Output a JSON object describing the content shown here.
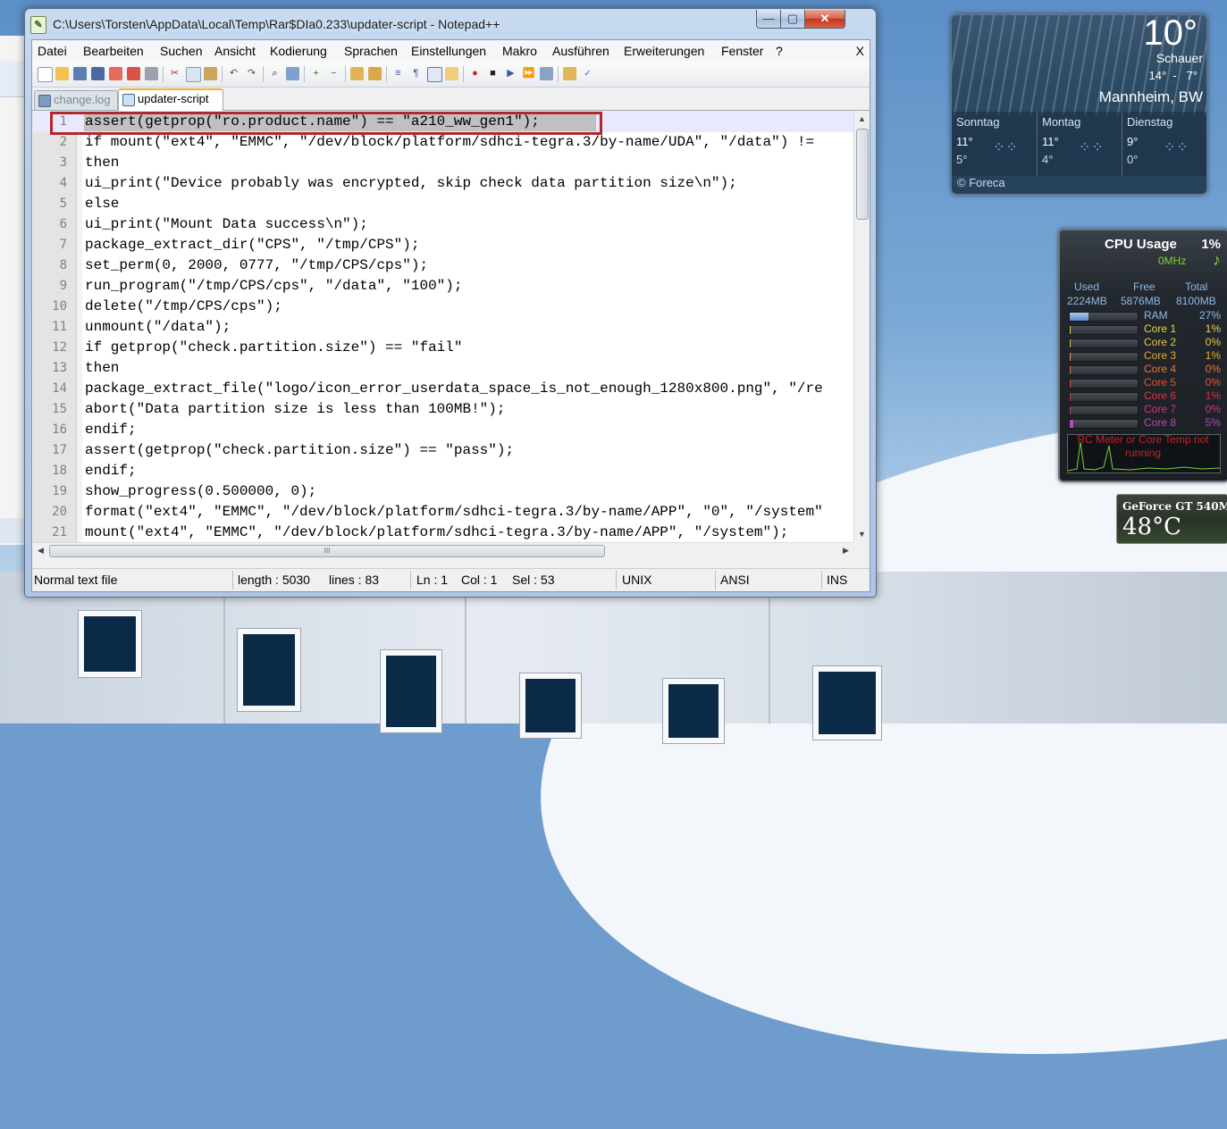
{
  "window": {
    "title": "C:\\Users\\Torsten\\AppData\\Local\\Temp\\Rar$DIa0.233\\updater-script - Notepad++",
    "close_glyph": "✕",
    "max_glyph": "▢",
    "min_glyph": "—"
  },
  "menu": {
    "items": [
      "Datei",
      "Bearbeiten",
      "Suchen",
      "Ansicht",
      "Kodierung",
      "Sprachen",
      "Einstellungen",
      "Makro",
      "Ausführen",
      "Erweiterungen",
      "Fenster",
      "?"
    ],
    "close": "X"
  },
  "toolbar": {
    "icons": [
      "new-file-icon",
      "open-file-icon",
      "save-icon",
      "save-all-icon",
      "close-icon",
      "close-all-icon",
      "print-icon",
      "cut-icon",
      "copy-icon",
      "paste-icon",
      "undo-icon",
      "redo-icon",
      "find-icon",
      "replace-icon",
      "zoom-in-icon",
      "zoom-out-icon",
      "sync-vertical-icon",
      "sync-horizontal-icon",
      "word-wrap-icon",
      "show-all-chars-icon",
      "indent-guide-icon",
      "doc-map-icon",
      "record-macro-icon",
      "stop-macro-icon",
      "play-macro-icon",
      "run-macro-multiple-icon",
      "save-macro-icon",
      "preview-icon",
      "spellcheck-icon"
    ]
  },
  "tabs": [
    {
      "label": "change.log",
      "active": false
    },
    {
      "label": "updater-script",
      "active": true
    }
  ],
  "editor": {
    "lines": [
      {
        "n": "1",
        "text": "assert(getprop(\"ro.product.name\") == \"a210_ww_gen1\");"
      },
      {
        "n": "2",
        "text": "if mount(\"ext4\", \"EMMC\", \"/dev/block/platform/sdhci-tegra.3/by-name/UDA\", \"/data\") !="
      },
      {
        "n": "3",
        "text": "then"
      },
      {
        "n": "4",
        "text": "ui_print(\"Device probably was encrypted, skip check data partition size\\n\");"
      },
      {
        "n": "5",
        "text": "else"
      },
      {
        "n": "6",
        "text": "ui_print(\"Mount Data success\\n\");"
      },
      {
        "n": "7",
        "text": "package_extract_dir(\"CPS\", \"/tmp/CPS\");"
      },
      {
        "n": "8",
        "text": "set_perm(0, 2000, 0777, \"/tmp/CPS/cps\");"
      },
      {
        "n": "9",
        "text": "run_program(\"/tmp/CPS/cps\", \"/data\", \"100\");"
      },
      {
        "n": "10",
        "text": "delete(\"/tmp/CPS/cps\");"
      },
      {
        "n": "11",
        "text": "unmount(\"/data\");"
      },
      {
        "n": "12",
        "text": "if getprop(\"check.partition.size\") == \"fail\""
      },
      {
        "n": "13",
        "text": "then"
      },
      {
        "n": "14",
        "text": "package_extract_file(\"logo/icon_error_userdata_space_is_not_enough_1280x800.png\", \"/re"
      },
      {
        "n": "15",
        "text": "abort(\"Data partition size is less than 100MB!\");"
      },
      {
        "n": "16",
        "text": "endif;"
      },
      {
        "n": "17",
        "text": "assert(getprop(\"check.partition.size\") == \"pass\");"
      },
      {
        "n": "18",
        "text": "endif;"
      },
      {
        "n": "19",
        "text": "show_progress(0.500000, 0);"
      },
      {
        "n": "20",
        "text": "format(\"ext4\", \"EMMC\", \"/dev/block/platform/sdhci-tegra.3/by-name/APP\", \"0\", \"/system\""
      },
      {
        "n": "21",
        "text": "mount(\"ext4\", \"EMMC\", \"/dev/block/platform/sdhci-tegra.3/by-name/APP\", \"/system\");"
      }
    ]
  },
  "scroll": {
    "up": "▲",
    "down": "▼",
    "left": "◀",
    "right": "▶",
    "grip": "III"
  },
  "status": {
    "type": "Normal text file",
    "length": "length : 5030",
    "lines": "lines : 83",
    "ln": "Ln : 1",
    "col": "Col : 1",
    "sel": "Sel : 53",
    "eol": "UNIX",
    "encoding": "ANSI",
    "mode": "INS"
  },
  "weather": {
    "temp": "10°",
    "condition": "Schauer",
    "range": "14°  -   7°",
    "city": "Mannheim, BW",
    "days": [
      {
        "name": "Sonntag",
        "hi": "11°",
        "lo": "5°"
      },
      {
        "name": "Montag",
        "hi": "11°",
        "lo": "4°"
      },
      {
        "name": "Dienstag",
        "hi": "9°",
        "lo": "0°"
      }
    ],
    "footer": "© Foreca"
  },
  "cpu": {
    "title": "CPU Usage",
    "percent": "1%",
    "mhz": "0MHz",
    "mem_headers": [
      "Used",
      "Free",
      "Total"
    ],
    "mem_values": [
      "2224MB",
      "5876MB",
      "8100MB"
    ],
    "rows": [
      {
        "name": "RAM",
        "value": "27%",
        "level": 0.27,
        "color": "#8fb8e6"
      },
      {
        "name": "Core 1",
        "value": "1%",
        "level": 0.01,
        "color": "#e7d24a"
      },
      {
        "name": "Core 2",
        "value": "0%",
        "level": 0.0,
        "color": "#e7c24a"
      },
      {
        "name": "Core 3",
        "value": "1%",
        "level": 0.01,
        "color": "#e6a93a"
      },
      {
        "name": "Core 4",
        "value": "0%",
        "level": 0.0,
        "color": "#e37a35"
      },
      {
        "name": "Core 5",
        "value": "0%",
        "level": 0.0,
        "color": "#e0553a"
      },
      {
        "name": "Core 6",
        "value": "1%",
        "level": 0.01,
        "color": "#d8364a"
      },
      {
        "name": "Core 7",
        "value": "0%",
        "level": 0.0,
        "color": "#cc3a7a"
      },
      {
        "name": "Core 8",
        "value": "5%",
        "level": 0.05,
        "color": "#b84ab8"
      }
    ],
    "warning": "RC Meter or Core Temp not running"
  },
  "gpu": {
    "name": "GeForce GT 540M",
    "temp": "48°C"
  }
}
